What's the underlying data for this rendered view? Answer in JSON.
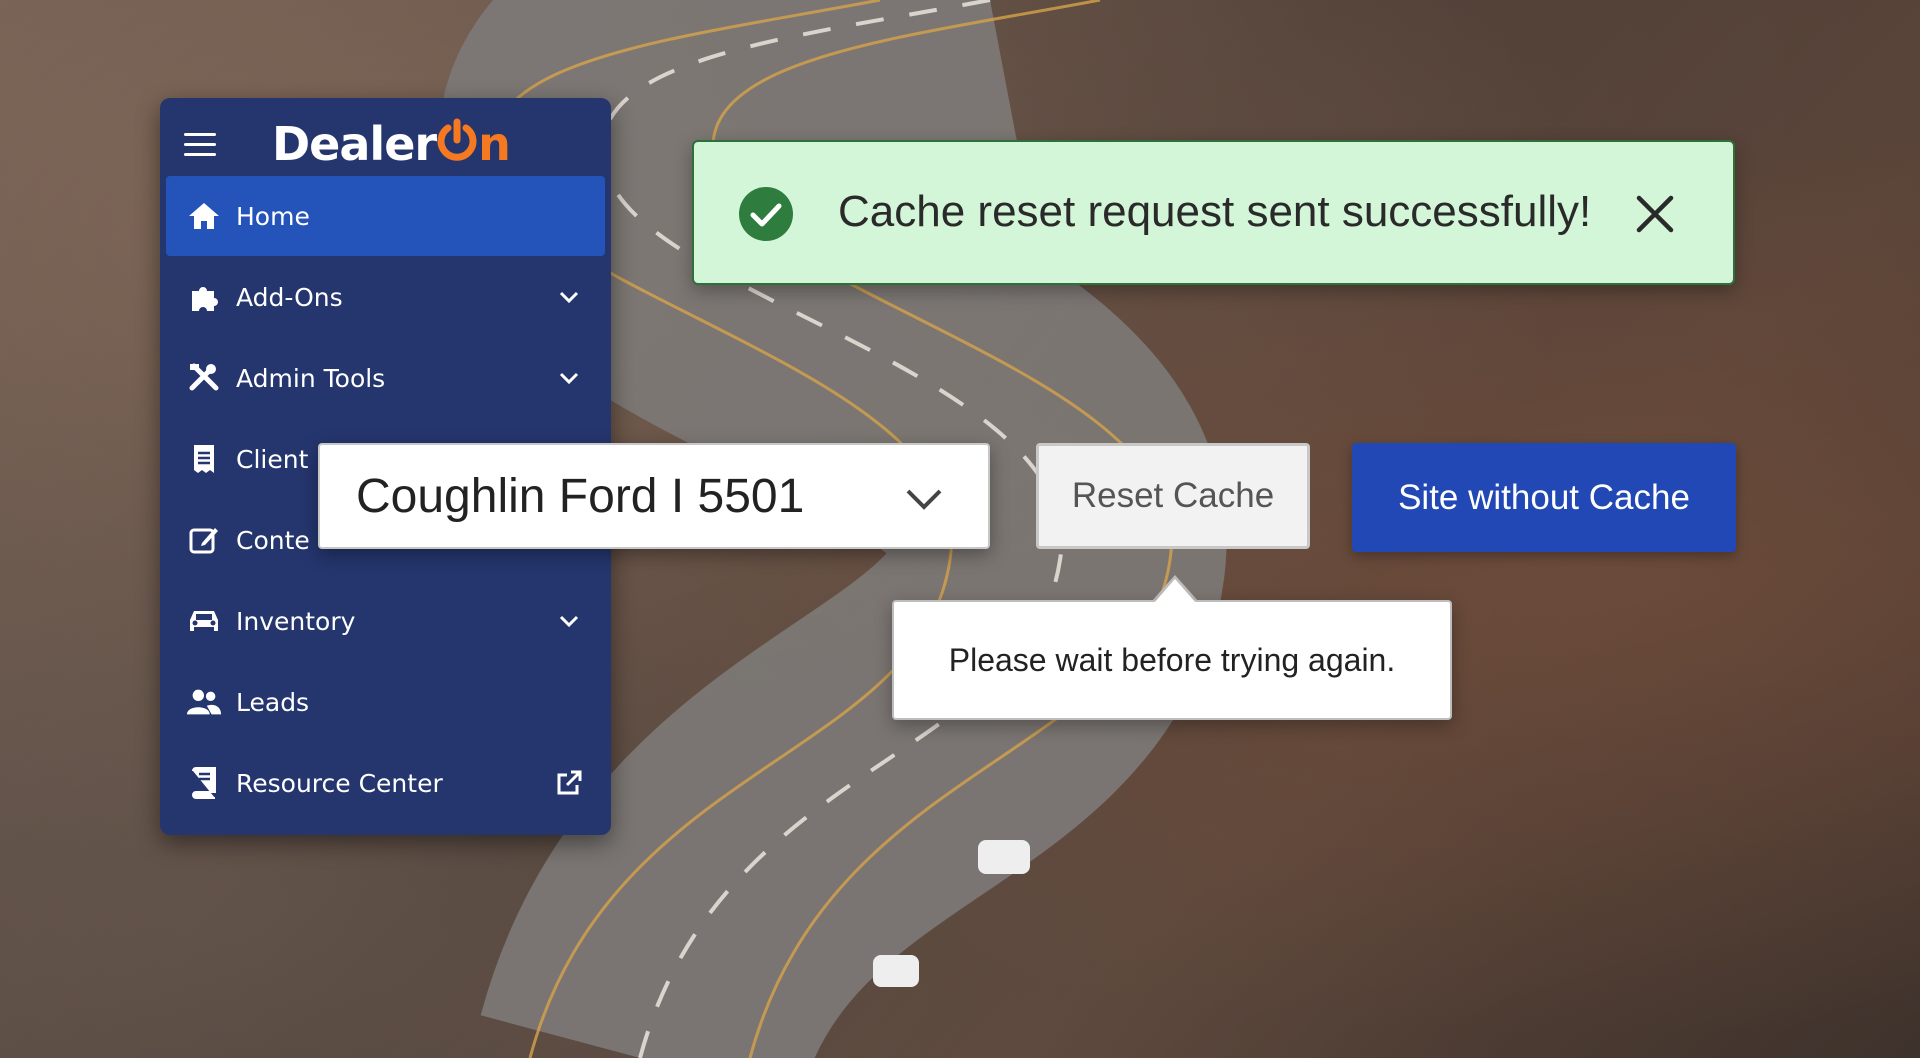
{
  "app": {
    "logo_text": "Dealer",
    "logo_accent": "n"
  },
  "sidebar": {
    "items": [
      {
        "label": "Home",
        "icon": "home-icon",
        "active": true
      },
      {
        "label": "Add-Ons",
        "icon": "puzzle-icon",
        "expandable": true
      },
      {
        "label": "Admin Tools",
        "icon": "tools-icon",
        "expandable": true
      },
      {
        "label": "Client",
        "icon": "receipt-icon"
      },
      {
        "label": "Conte",
        "icon": "edit-icon"
      },
      {
        "label": "Inventory",
        "icon": "car-icon",
        "expandable": true
      },
      {
        "label": "Leads",
        "icon": "users-icon"
      },
      {
        "label": "Resource Center",
        "icon": "book-icon",
        "external": true
      }
    ]
  },
  "dealer_select": {
    "value": "Coughlin Ford  I  5501"
  },
  "actions": {
    "reset_cache_label": "Reset Cache",
    "site_without_cache_label": "Site without Cache"
  },
  "tooltip": {
    "text": "Please wait before trying again."
  },
  "toast": {
    "message": "Cache reset request sent successfully!"
  },
  "colors": {
    "sidebar_bg": "#25366e",
    "active_item": "#2453b9",
    "brand_orange": "#f47920",
    "primary_button": "#2148b4",
    "toast_bg": "#d3f5d8",
    "success_green": "#2f7d3e"
  }
}
